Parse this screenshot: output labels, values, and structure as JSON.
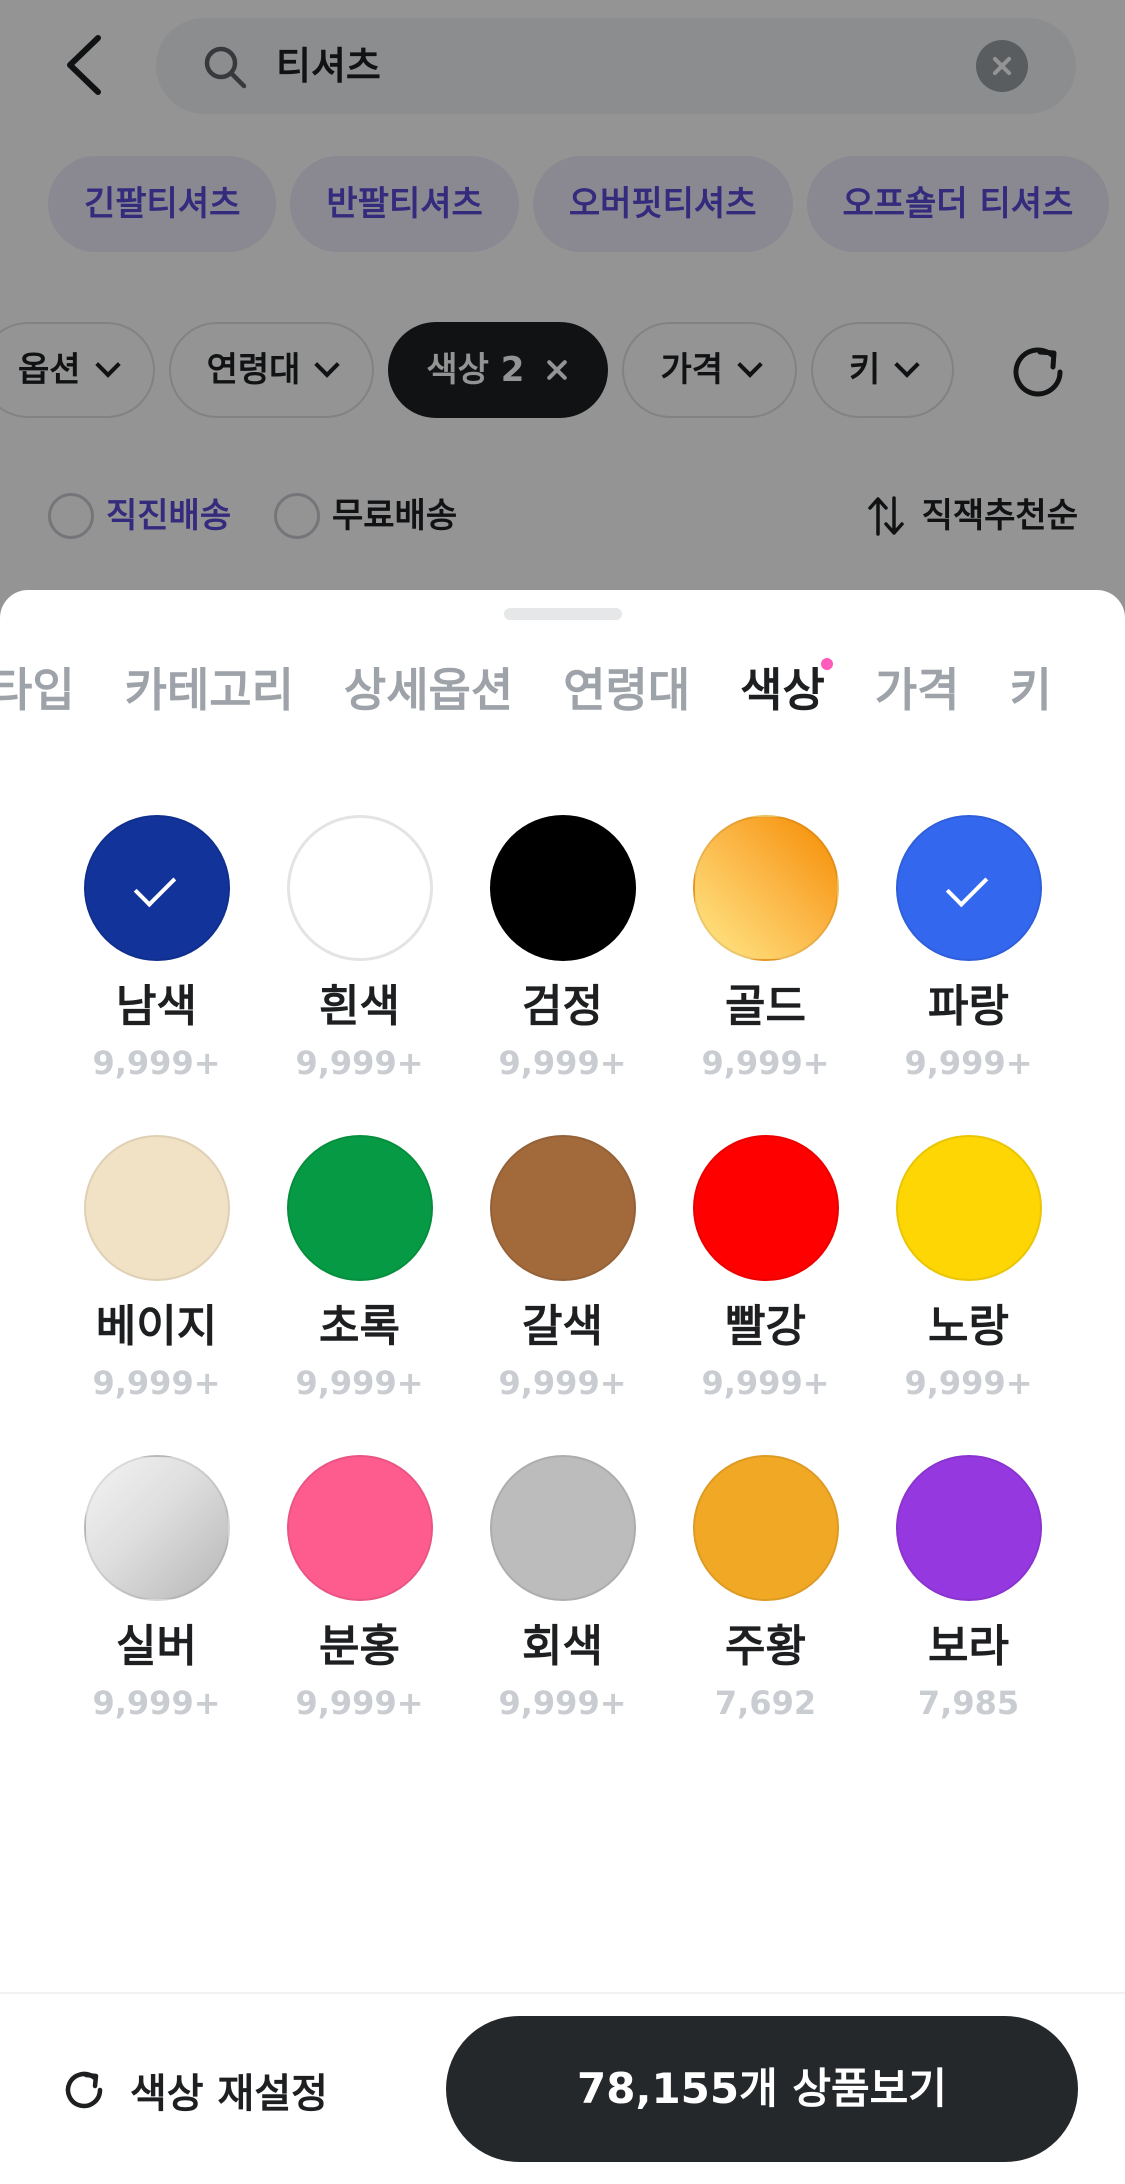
{
  "header": {
    "search_value": "티셔츠"
  },
  "related_keywords": [
    "긴팔티셔츠",
    "반팔티셔츠",
    "오버핏티셔츠",
    "오프숄더 티셔츠"
  ],
  "filter_chips": {
    "option": "옵션",
    "age": "연령대",
    "color": "색상 2",
    "price": "가격",
    "height": "키"
  },
  "options": {
    "direct_delivery": "직진배송",
    "free_delivery": "무료배송",
    "sort": "직잭추천순"
  },
  "sheet": {
    "tabs": [
      "타입",
      "카테고리",
      "상세옵션",
      "연령대",
      "색상",
      "가격",
      "키"
    ],
    "active_tab": "색상",
    "colors": [
      {
        "name": "남색",
        "count": "9,999+",
        "color": "#12349a",
        "checked": true
      },
      {
        "name": "흰색",
        "count": "9,999+",
        "color": "#ffffff",
        "checked": false
      },
      {
        "name": "검정",
        "count": "9,999+",
        "color": "#000000",
        "checked": false
      },
      {
        "name": "골드",
        "count": "9,999+",
        "color": "#f7b23b",
        "checked": false
      },
      {
        "name": "파랑",
        "count": "9,999+",
        "color": "#3367ee",
        "checked": true
      },
      {
        "name": "베이지",
        "count": "9,999+",
        "color": "#f2e2c5",
        "checked": false
      },
      {
        "name": "초록",
        "count": "9,999+",
        "color": "#079a44",
        "checked": false
      },
      {
        "name": "갈색",
        "count": "9,999+",
        "color": "#a26a3b",
        "checked": false
      },
      {
        "name": "빨강",
        "count": "9,999+",
        "color": "#ff0000",
        "checked": false
      },
      {
        "name": "노랑",
        "count": "9,999+",
        "color": "#fed604",
        "checked": false
      },
      {
        "name": "실버",
        "count": "9,999+",
        "color": "#d2d2d2",
        "checked": false
      },
      {
        "name": "분홍",
        "count": "9,999+",
        "color": "#fe5c8f",
        "checked": false
      },
      {
        "name": "회색",
        "count": "9,999+",
        "color": "#bcbcbc",
        "checked": false
      },
      {
        "name": "주황",
        "count": "7,692",
        "color": "#f1a825",
        "checked": false
      },
      {
        "name": "보라",
        "count": "7,985",
        "color": "#9638e0",
        "checked": false
      }
    ]
  },
  "footer": {
    "reset_label": "색상 재설정",
    "view_label": "78,155개 상품보기"
  }
}
